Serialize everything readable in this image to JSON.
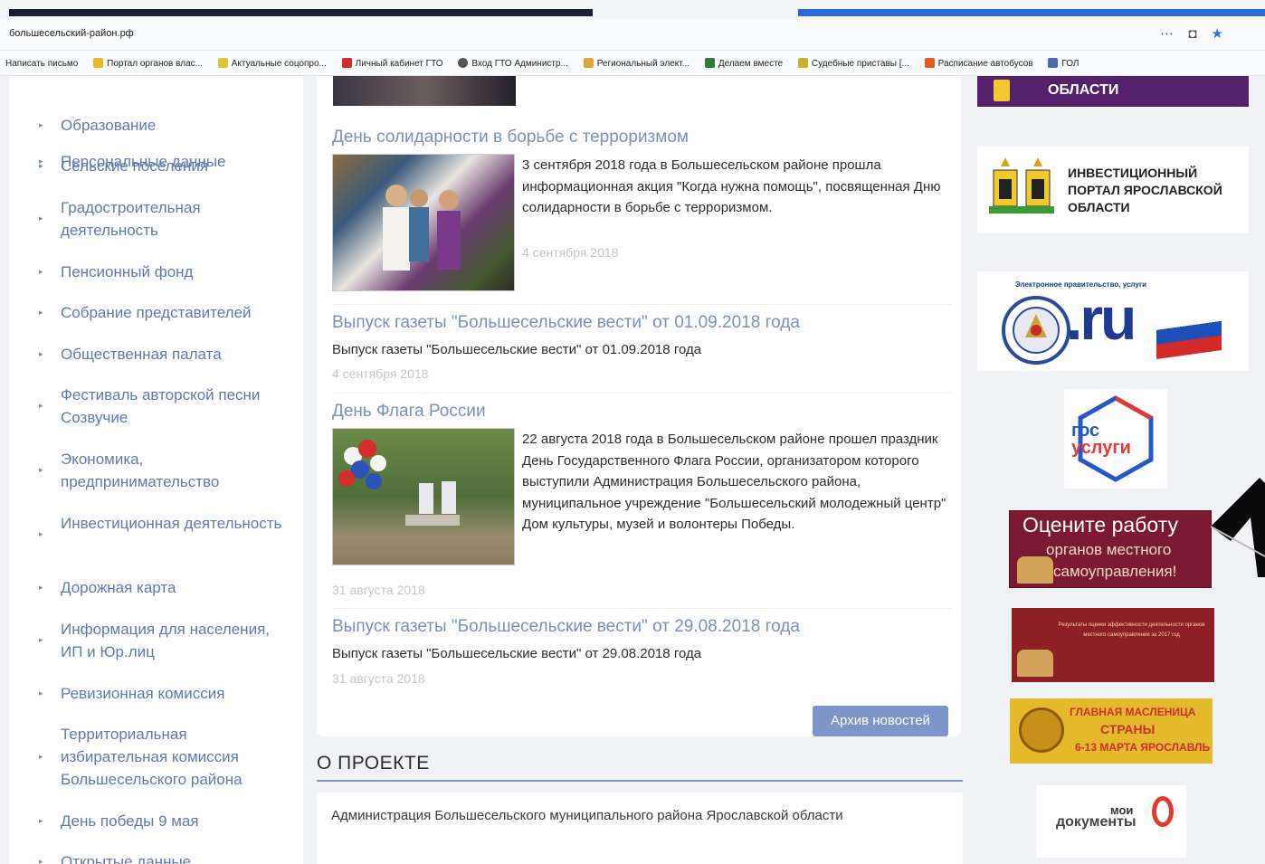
{
  "browser": {
    "url": "большесельский-район.рф",
    "bookmarks": [
      "Написать письмо",
      "Портал органов влас...",
      "Актуальные соцопро...",
      "Личный кабинет ГТО",
      "Вход ГТО Администр...",
      "Региональный элект...",
      "Делаем вместе",
      "Судебные приставы [...",
      "Расписание автобусов",
      "ГОЛ"
    ]
  },
  "sidebar": {
    "items": [
      "Персональные данные",
      "Образование",
      "Сельские поселения",
      "Градостроительная деятельность",
      "Пенсионный фонд",
      "Собрание представителей",
      "Общественная палата",
      "Фестиваль авторской песни Созвучие",
      "Экономика, предпринимательство",
      "Инвестиционная деятельность",
      "Дорожная карта",
      "Информация для населения, ИП и Юр.лиц",
      "Ревизионная комиссия",
      "Территориальная избирательная комиссия Большесельского района",
      "День победы 9 мая",
      "Открытые данные"
    ]
  },
  "news": {
    "items": [
      {
        "title": "День солидарности в борьбе с терроризмом",
        "text": "3 сентября 2018 года в Большесельском районе прошла информационная акция \"Когда нужна помощь\", посвященная Дню солидарности в борьбе с терроризмом.",
        "date": "4 сентября 2018"
      },
      {
        "title": "Выпуск газеты \"Большесельские вести\" от 01.09.2018 года",
        "text": "Выпуск газеты \"Большесельские вести\" от 01.09.2018 года",
        "date": "4 сентября 2018"
      },
      {
        "title": "День Флага России",
        "text": "22 августа 2018 года в Большесельском районе прошел праздник День Государственного Флага России, организатором которого выступили Администрация Большесельского района, муниципальное учреждение \"Большесельский молодежный центр\" Дом культуры, музей и волонтеры Победы.",
        "date": "31 августа 2018"
      },
      {
        "title": "Выпуск газеты \"Большесельские вести\" от 29.08.2018 года",
        "text": "Выпуск газеты \"Большесельские вести\" от 29.08.2018 года",
        "date": "31 августа 2018"
      }
    ],
    "archive_button": "Архив новостей"
  },
  "about": {
    "title": "О ПРОЕКТЕ",
    "text": "Администрация Большесельского муниципального района Ярославской области"
  },
  "banners": {
    "yar_top": "ОБЛАСТИ",
    "invest": "ИНВЕСТИЦИОННЫЙ ПОРТАЛ ЯРОСЛАВСКОЙ ОБЛАСТИ",
    "gosru_caption": "Электронное правительство, услуги",
    "gosru_logo": ".ru",
    "gosuslugi_line1": "гос",
    "gosuslugi_line2": "услуги",
    "rate_line1": "Оцените работу",
    "rate_line2": "органов местного",
    "rate_line3": "самоуправления!",
    "result": "Результаты оценки эффективности деятельности органов местного самоуправления за 2017 год",
    "maslen_line1": "ГЛАВНАЯ МАСЛЕНИЦА",
    "maslen_line2": "СТРАНЫ",
    "maslen_line3": "6-13 МАРТА ЯРОСЛАВЛЬ",
    "moidoc_line1": "мои",
    "moidoc_line2": "документы"
  },
  "colors": {
    "link": "#6079b5",
    "news_title": "#7b8fc0",
    "archive_button": "#7d95c8",
    "rate_banner": "#7b1a32"
  }
}
